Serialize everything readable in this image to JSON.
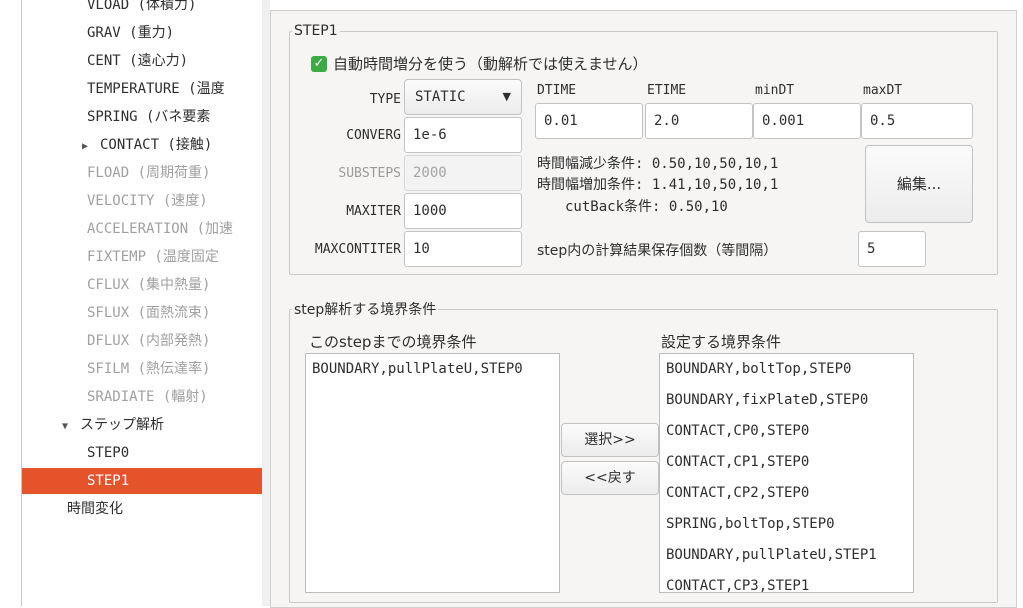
{
  "tree": {
    "items": [
      {
        "label": "VLOAD (体積力)",
        "state": "normal",
        "indent": 86
      },
      {
        "label": "GRAV (重力)",
        "state": "normal",
        "indent": 86
      },
      {
        "label": "CENT (遠心力)",
        "state": "normal",
        "indent": 86
      },
      {
        "label": "TEMPERATURE (温度",
        "state": "normal",
        "indent": 86
      },
      {
        "label": "SPRING (バネ要素",
        "state": "normal",
        "indent": 86
      },
      {
        "label": "CONTACT (接触)",
        "state": "normal",
        "indent": 86,
        "expander": "collapsed"
      },
      {
        "label": "FLOAD (周期荷重)",
        "state": "dim",
        "indent": 86
      },
      {
        "label": "VELOCITY (速度)",
        "state": "dim",
        "indent": 86
      },
      {
        "label": "ACCELERATION (加速",
        "state": "dim",
        "indent": 86
      },
      {
        "label": "FIXTEMP (温度固定",
        "state": "dim",
        "indent": 86
      },
      {
        "label": "CFLUX (集中熱量)",
        "state": "dim",
        "indent": 86
      },
      {
        "label": "SFLUX (面熱流束)",
        "state": "dim",
        "indent": 86
      },
      {
        "label": "DFLUX (内部発熱)",
        "state": "dim",
        "indent": 86
      },
      {
        "label": "SFILM (熱伝達率)",
        "state": "dim",
        "indent": 86
      },
      {
        "label": "SRADIATE (輻射)",
        "state": "dim",
        "indent": 86
      },
      {
        "label": "ステップ解析",
        "state": "normal",
        "indent": 66,
        "expander": "expanded"
      },
      {
        "label": "STEP0",
        "state": "normal",
        "indent": 86
      },
      {
        "label": "STEP1",
        "state": "selected",
        "indent": 86
      },
      {
        "label": "時間変化",
        "state": "normal",
        "indent": 66
      }
    ],
    "arrow_collapsed": "▶",
    "arrow_expanded": "▼"
  },
  "step": {
    "legend": "STEP1",
    "auto_increment_label": "自動時間増分を使う（動解析では使えません）",
    "auto_increment_checked": true,
    "type_label": "TYPE",
    "type_value": "STATIC",
    "converg_label": "CONVERG",
    "converg_value": "1e-6",
    "substeps_label": "SUBSTEPS",
    "substeps_value": "2000",
    "maxiter_label": "MAXITER",
    "maxiter_value": "1000",
    "maxcontiter_label": "MAXCONTITER",
    "maxcontiter_value": "10",
    "dtime_label": "DTIME",
    "dtime_value": "0.01",
    "etime_label": "ETIME",
    "etime_value": "2.0",
    "mindt_label": "minDT",
    "mindt_value": "0.001",
    "maxdt_label": "maxDT",
    "maxdt_value": "0.5",
    "decrease_text": "時間幅減少条件: 0.50,10,50,10,1",
    "increase_text": "時間幅増加条件: 1.41,10,50,10,1",
    "cutback_text": "cutBack条件: 0.50,10",
    "edit_button": "編集...",
    "save_count_label": "step内の計算結果保存個数（等間隔）",
    "save_count_value": "5"
  },
  "boundary": {
    "legend": "step解析する境界条件",
    "left_title": "このstepまでの境界条件",
    "left_items": [
      "BOUNDARY,pullPlateU,STEP0"
    ],
    "right_title": "設定する境界条件",
    "right_items": [
      "BOUNDARY,boltTop,STEP0",
      "BOUNDARY,fixPlateD,STEP0",
      "CONTACT,CP0,STEP0",
      "CONTACT,CP1,STEP0",
      "CONTACT,CP2,STEP0",
      "SPRING,boltTop,STEP0",
      "BOUNDARY,pullPlateU,STEP1",
      "CONTACT,CP3,STEP1"
    ],
    "select_button": "選択>>",
    "back_button": "<<戻す"
  }
}
